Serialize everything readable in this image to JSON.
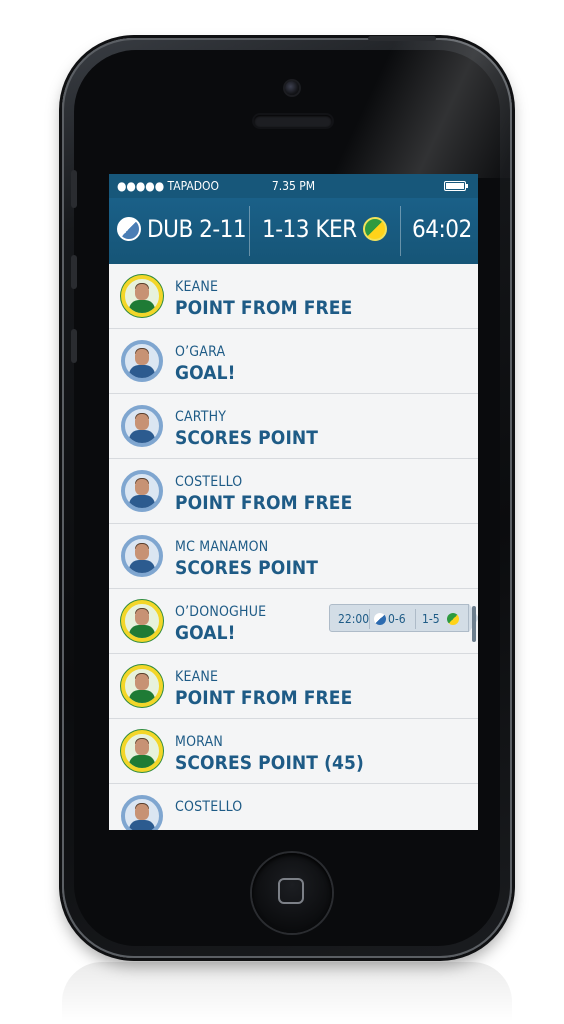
{
  "status_bar": {
    "carrier": "●●●●● TAPADOO",
    "time": "7.35 PM"
  },
  "scoreboard": {
    "home": "DUB 2-11",
    "away": "1-13 KER",
    "clock": "64:02"
  },
  "feed": [
    {
      "player": "KEANE",
      "event": "POINT FROM FREE",
      "team": "ker"
    },
    {
      "player": "O’GARA",
      "event": "GOAL!",
      "team": "dub"
    },
    {
      "player": "CARTHY",
      "event": "SCORES POINT",
      "team": "dub"
    },
    {
      "player": "COSTELLO",
      "event": "POINT FROM FREE",
      "team": "dub"
    },
    {
      "player": "MC MANAMON",
      "event": "SCORES POINT",
      "team": "dub"
    },
    {
      "player": "O’DONOGHUE",
      "event": "GOAL!",
      "team": "ker"
    },
    {
      "player": "KEANE",
      "event": "POINT FROM FREE",
      "team": "ker"
    },
    {
      "player": "MORAN",
      "event": "SCORES POINT (45)",
      "team": "ker"
    },
    {
      "player": "COSTELLO",
      "event": "",
      "team": "dub"
    }
  ],
  "score_popup": {
    "time": "22:00",
    "home": "0-6",
    "away": "1-5"
  },
  "colors": {
    "header_blue": "#17577a",
    "text_blue": "#1e5b86",
    "dub_ring": "#7fa6d0",
    "ker_ring": "#f3d629"
  }
}
